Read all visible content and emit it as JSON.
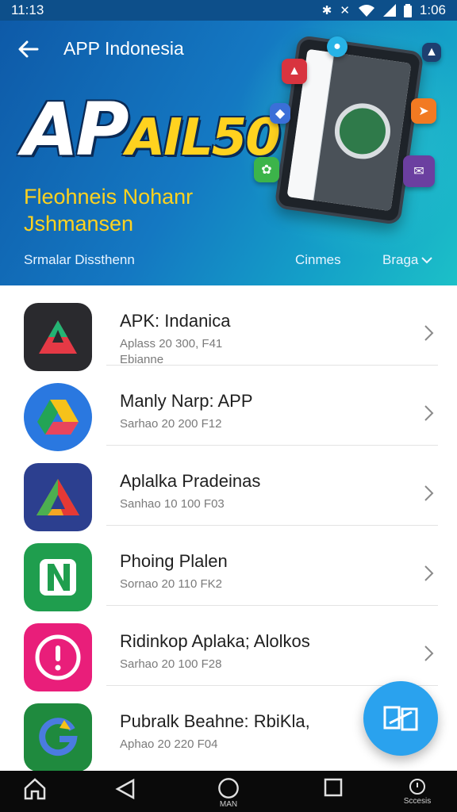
{
  "status": {
    "time": "11:13",
    "right_time": "1:06",
    "icons": [
      "bluetooth-icon",
      "vibrate-icon",
      "wifi-icon",
      "signal-icon",
      "battery-icon"
    ]
  },
  "header": {
    "title": "APP Indonesia",
    "logo_part1": "AP",
    "logo_part2": "AIL50",
    "tagline_line1": "Fleohneis Nohanr",
    "tagline_line2": "Jshmansen",
    "link_left": "Srmalar Dissthenn",
    "link_mid": "Cinmes",
    "link_right": "Braga"
  },
  "apps": [
    {
      "name": "APK: Indanica",
      "meta_line1": "Aplass 20 300, F41",
      "meta_line2": "Ebianne",
      "icon": "triangle-logo-icon"
    },
    {
      "name": "Manly Narp: APP",
      "meta_line1": "Sarhao 20 200 F12",
      "meta_line2": "",
      "icon": "drive-triangle-icon"
    },
    {
      "name": "Aplalka Pradeinas",
      "meta_line1": "Sanhao 10 100 F03",
      "meta_line2": "",
      "icon": "colorful-triangle-icon"
    },
    {
      "name": "Phoing Plalen",
      "meta_line1": "Sornao 20 110 FK2",
      "meta_line2": "",
      "icon": "green-n-icon"
    },
    {
      "name": "Ridinkop Aplaka; Alolkos",
      "meta_line1": "Sarhao 20 100 F28",
      "meta_line2": "",
      "icon": "alert-circle-icon"
    },
    {
      "name": "Pubralk Beahne: RbiKla,",
      "meta_line1": "Aphao 20 220 F04",
      "meta_line2": "",
      "icon": "g-logo-icon"
    }
  ],
  "nav": {
    "circle_label": "MAN",
    "right_label": "Sccesis"
  },
  "colors": {
    "accent": "#2aa2ee",
    "banner": "#1478c2",
    "tagline": "#ffd21f"
  }
}
